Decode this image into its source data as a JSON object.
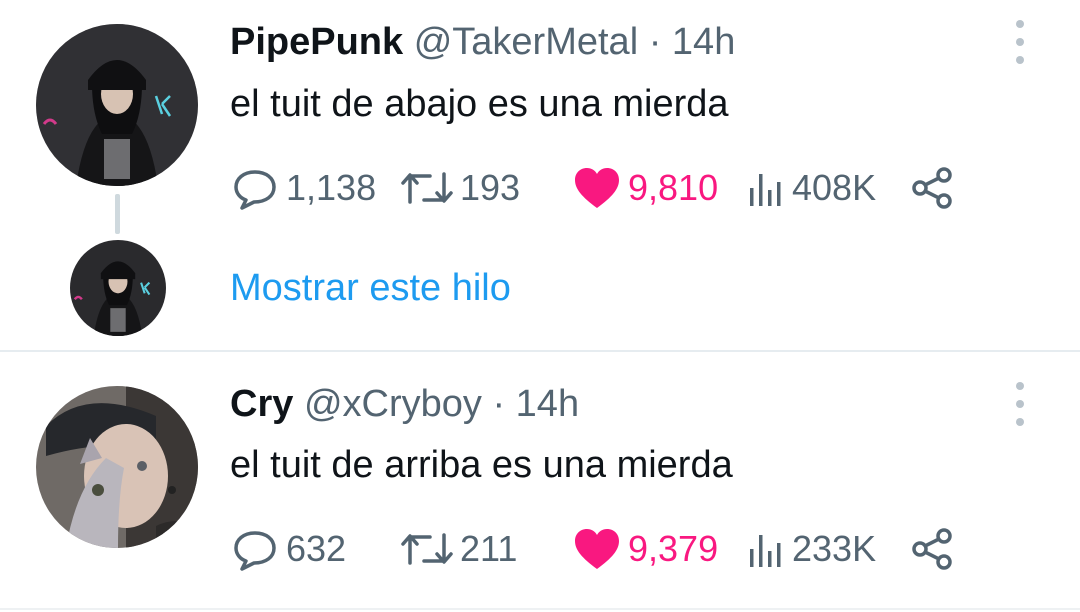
{
  "tweets": [
    {
      "display_name": "PipePunk",
      "handle": "@TakerMetal",
      "separator": "·",
      "time": "14h",
      "text": "el tuit de abajo es una mierda",
      "replies": "1,138",
      "retweets": "193",
      "likes": "9,810",
      "views": "408K",
      "show_thread": "Mostrar este hilo"
    },
    {
      "display_name": "Cry",
      "handle": "@xCryboy",
      "separator": "·",
      "time": "14h",
      "text": "el tuit de arriba es una mierda",
      "replies": "632",
      "retweets": "211",
      "likes": "9,379",
      "views": "233K"
    }
  ],
  "icons": {
    "reply": "reply-icon",
    "retweet": "retweet-icon",
    "like": "heart-icon",
    "views": "views-icon",
    "share": "share-icon",
    "more": "more-vertical-icon"
  },
  "colors": {
    "like": "#f91880",
    "link": "#1d9bf0",
    "secondary_text": "#536471",
    "primary_text": "#0f1419"
  }
}
